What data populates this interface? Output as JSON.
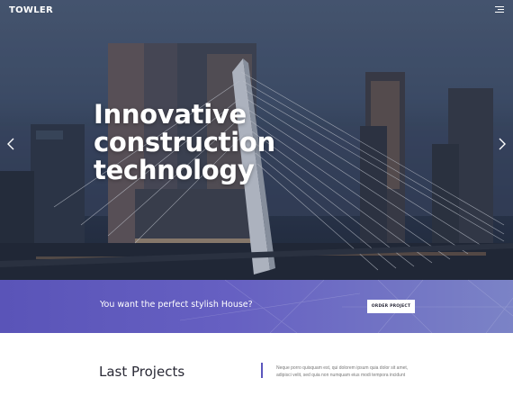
{
  "header": {
    "logo": "TOWLER",
    "menu_icon": "hamburger-icon"
  },
  "hero": {
    "title_line1": "Innovative",
    "title_line2": "construction",
    "title_line3": "technology",
    "prev_icon": "chevron-left-icon",
    "next_icon": "chevron-right-icon"
  },
  "cta": {
    "text": "You want the perfect stylish House?",
    "button_label": "ORDER PROJECT",
    "accent_color": "#5b56bd"
  },
  "projects": {
    "title": "Last Projects",
    "description_line1": "Neque porro quisquam est, qui dolorem ipsum quia dolor sit amet,",
    "description_line2": "adipisci velit, sed quia non numquam eius modi tempora incidunt"
  }
}
